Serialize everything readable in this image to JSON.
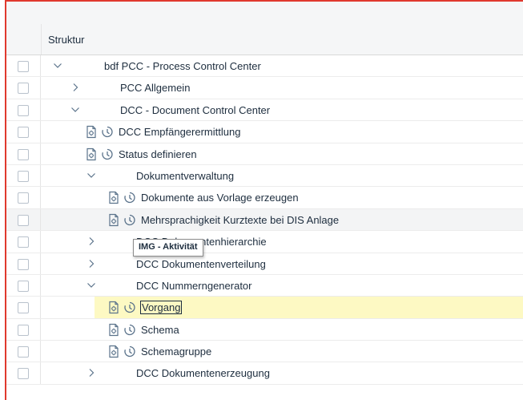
{
  "table": {
    "column_header": "Struktur"
  },
  "tree": [
    {
      "label": "bdf PCC - Process Control Center",
      "level": 0,
      "expander": "down",
      "icons": false
    },
    {
      "label": "PCC Allgemein",
      "level": 1,
      "expander": "right",
      "icons": false
    },
    {
      "label": "DCC - Document Control Center",
      "level": 1,
      "expander": "down",
      "icons": false
    },
    {
      "label": "DCC Empfängerermittlung",
      "level": 2,
      "expander": "none",
      "icons": true
    },
    {
      "label": "Status definieren",
      "level": 2,
      "expander": "none",
      "icons": true
    },
    {
      "label": "Dokumentverwaltung",
      "level": 2,
      "expander": "down",
      "icons": false
    },
    {
      "label": "Dokumente aus Vorlage erzeugen",
      "level": 3,
      "expander": "none",
      "icons": true
    },
    {
      "label": "Mehrsprachigkeit Kurztexte bei DIS Anlage",
      "level": 3,
      "expander": "none",
      "icons": true,
      "hover": true
    },
    {
      "label": "DCC Dokumentenhierarchie",
      "level": 2,
      "expander": "right",
      "icons": false
    },
    {
      "label": "DCC Dokumentenverteilung",
      "level": 2,
      "expander": "right",
      "icons": false
    },
    {
      "label": "DCC Nummerngenerator",
      "level": 2,
      "expander": "down",
      "icons": false
    },
    {
      "label": "Vorgang",
      "level": 3,
      "expander": "none",
      "icons": true,
      "selected": true
    },
    {
      "label": "Schema",
      "level": 3,
      "expander": "none",
      "icons": true
    },
    {
      "label": "Schemagruppe",
      "level": 3,
      "expander": "none",
      "icons": true
    },
    {
      "label": "DCC Dokumentenerzeugung",
      "level": 2,
      "expander": "right",
      "icons": false
    }
  ],
  "tooltip": {
    "text": "IMG - Aktivität"
  },
  "colors": {
    "accent_border": "#e0392e",
    "selection_highlight": "#fdf9c3",
    "icon": "#5b738b"
  }
}
